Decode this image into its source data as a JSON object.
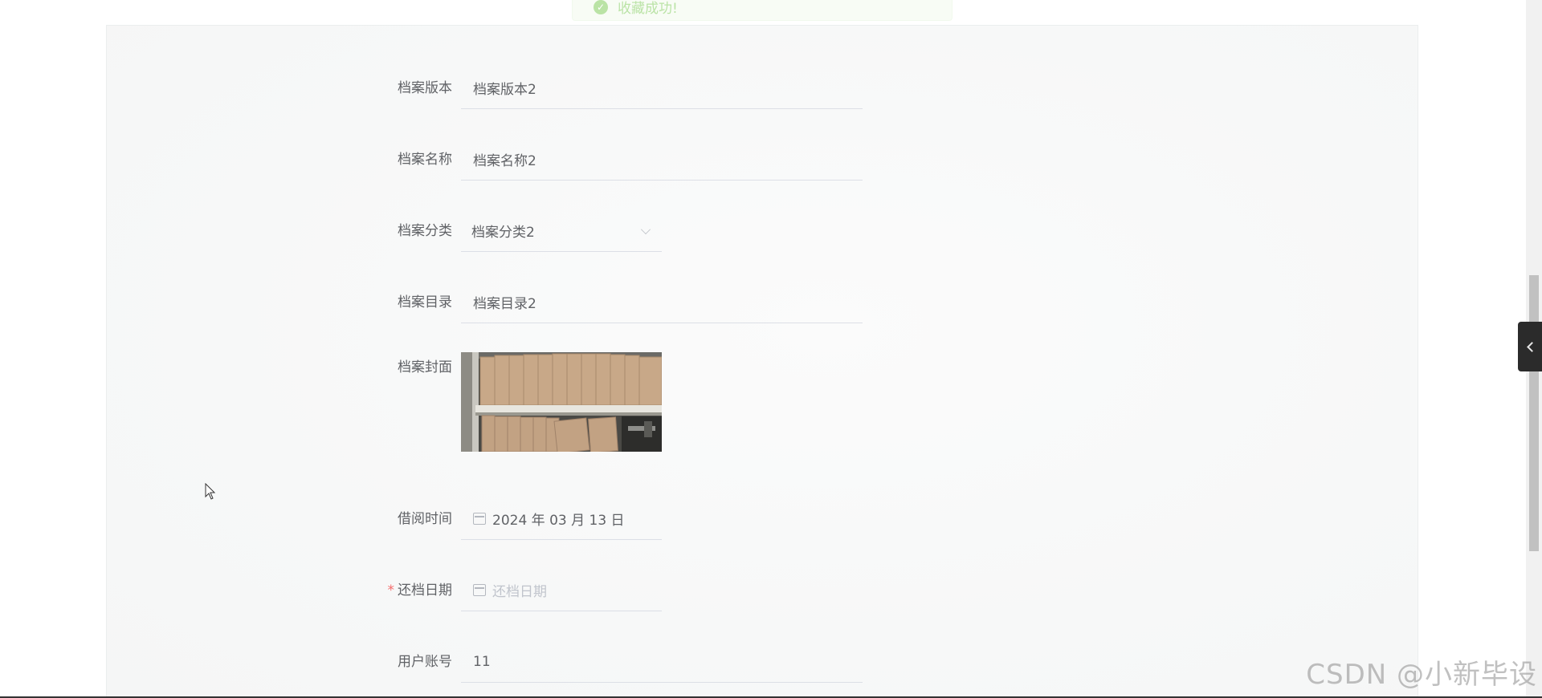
{
  "toast": {
    "message": "收藏成功!"
  },
  "form": {
    "version": {
      "label": "档案版本",
      "value": "档案版本2"
    },
    "name": {
      "label": "档案名称",
      "value": "档案名称2"
    },
    "category": {
      "label": "档案分类",
      "value": "档案分类2"
    },
    "catalog": {
      "label": "档案目录",
      "value": "档案目录2"
    },
    "cover": {
      "label": "档案封面"
    },
    "borrow_time": {
      "label": "借阅时间",
      "value": "2024 年 03 月 13 日"
    },
    "return_date": {
      "label": "还档日期",
      "required_mark": "*",
      "placeholder": "还档日期"
    },
    "user_account": {
      "label": "用户账号",
      "value": "11"
    }
  },
  "watermark": "CSDN @小新毕设",
  "colors": {
    "required": "#f56c6c",
    "success": "#67c23a",
    "text": "#606266",
    "placeholder": "#c0c4cc"
  }
}
